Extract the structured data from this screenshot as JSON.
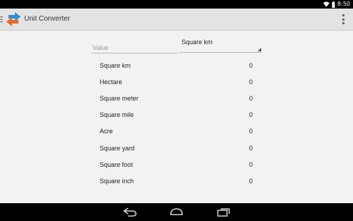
{
  "status_bar": {
    "time": "8:50",
    "icons": [
      "wifi-icon",
      "battery-icon"
    ]
  },
  "action_bar": {
    "title": "Unit Converter",
    "logo_icon": "unit-converter-logo",
    "overflow_icon": "overflow-menu-icon"
  },
  "converter": {
    "value_placeholder": "Value",
    "value": "",
    "selected_unit": "Square km"
  },
  "results": [
    {
      "unit": "Square km",
      "value": "0"
    },
    {
      "unit": "Hectare",
      "value": "0"
    },
    {
      "unit": "Square meter",
      "value": "0"
    },
    {
      "unit": "Square mile",
      "value": "0"
    },
    {
      "unit": "Acre",
      "value": "0"
    },
    {
      "unit": "Square yard",
      "value": "0"
    },
    {
      "unit": "Square foot",
      "value": "0"
    },
    {
      "unit": "Square inch",
      "value": "0"
    }
  ],
  "nav_bar": {
    "buttons": [
      "back-icon",
      "home-icon",
      "recents-icon"
    ]
  },
  "colors": {
    "logo_blue": "#2e8fd8",
    "logo_orange": "#e8672a",
    "action_bar": "#e3e3e3",
    "background": "#f2f2f2"
  }
}
